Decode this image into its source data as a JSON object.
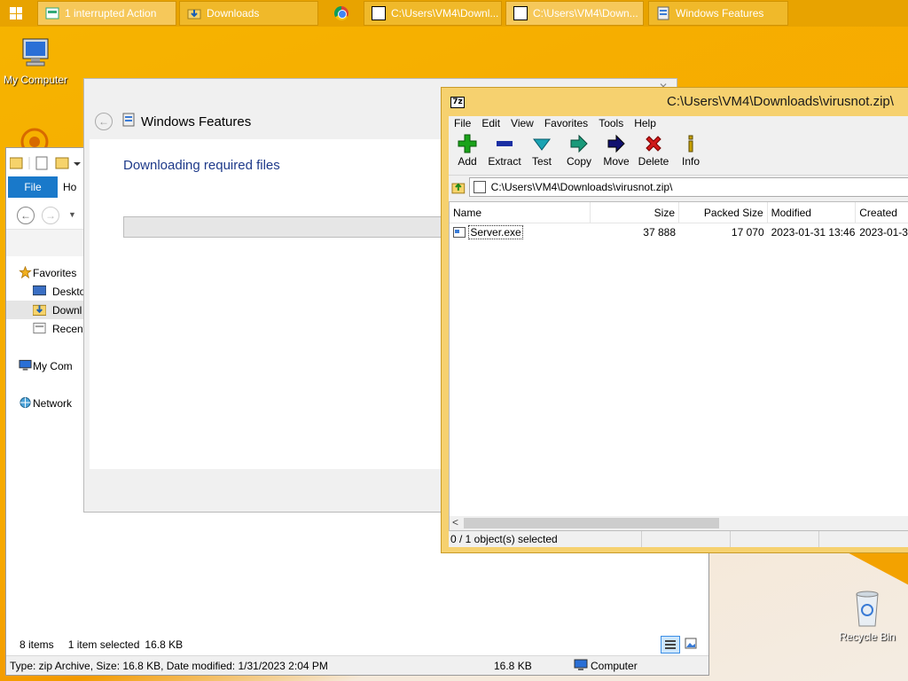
{
  "taskbar": {
    "buttons": [
      {
        "label": "1 interrupted Action",
        "icon": "installer-icon"
      },
      {
        "label": "Downloads",
        "icon": "folder-download-icon"
      },
      {
        "label": "C:\\Users\\VM4\\Downl...",
        "icon": "7zip-icon"
      },
      {
        "label": "C:\\Users\\VM4\\Down...",
        "icon": "7zip-icon"
      },
      {
        "label": "Windows Features",
        "icon": "windows-features-icon"
      }
    ],
    "pinned": "chrome-icon"
  },
  "desktop": {
    "my_computer": "My Computer",
    "recycle_bin": "Recycle Bin"
  },
  "explorer": {
    "tabs": {
      "file": "File",
      "home": "Ho"
    },
    "sidebar": [
      {
        "label": "Favorites",
        "icon": "star-icon"
      },
      {
        "label": "Deskto",
        "icon": "desktop-icon"
      },
      {
        "label": "Downl",
        "icon": "downloads-folder-icon"
      },
      {
        "label": "Recent",
        "icon": "recent-places-icon"
      },
      {
        "label": "My Com",
        "icon": "computer-icon"
      },
      {
        "label": "Network",
        "icon": "network-icon"
      }
    ],
    "status": {
      "items": "8 items",
      "selected": "1 item selected",
      "size": "16.8 KB"
    },
    "details": {
      "type": "Type: zip Archive, Size: 16.8 KB, Date modified: 1/31/2023 2:04 PM",
      "size": "16.8 KB",
      "location": "Computer"
    }
  },
  "windows_features": {
    "title": "Windows Features",
    "heading": "Downloading required files"
  },
  "zip": {
    "title": "C:\\Users\\VM4\\Downloads\\virusnot.zip\\",
    "menu": [
      "File",
      "Edit",
      "View",
      "Favorites",
      "Tools",
      "Help"
    ],
    "toolbar": [
      {
        "label": "Add",
        "icon": "add-icon",
        "color": "#1aa31a"
      },
      {
        "label": "Extract",
        "icon": "extract-icon",
        "color": "#1a2fa3"
      },
      {
        "label": "Test",
        "icon": "test-icon",
        "color": "#1aa3b3"
      },
      {
        "label": "Copy",
        "icon": "copy-icon",
        "color": "#1a9a7a"
      },
      {
        "label": "Move",
        "icon": "move-icon",
        "color": "#101070"
      },
      {
        "label": "Delete",
        "icon": "delete-icon",
        "color": "#d01818"
      },
      {
        "label": "Info",
        "icon": "info-icon",
        "color": "#c8a000"
      }
    ],
    "address": "C:\\Users\\VM4\\Downloads\\virusnot.zip\\",
    "columns": [
      "Name",
      "Size",
      "Packed Size",
      "Modified",
      "Created"
    ],
    "rows": [
      {
        "name": "Server.exe",
        "size": "37 888",
        "packed": "17 070",
        "modified": "2023-01-31 13:46",
        "created": "2023-01-3"
      }
    ],
    "status": "0 / 1 object(s) selected"
  }
}
